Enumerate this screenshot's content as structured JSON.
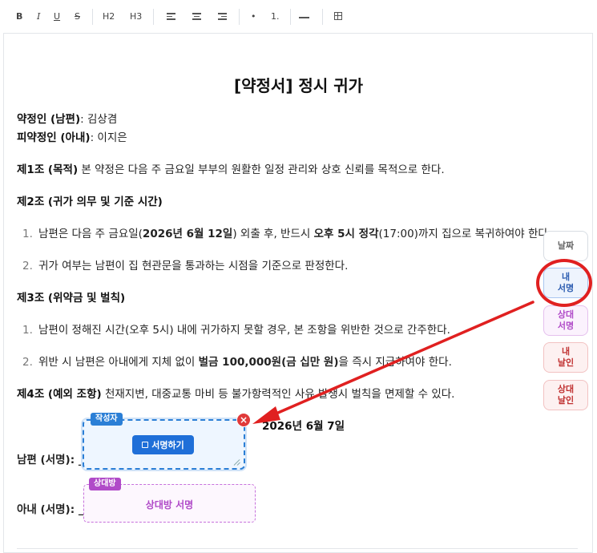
{
  "toolbar": {
    "bold": "B",
    "italic": "I",
    "underline": "U",
    "strike": "S",
    "h2": "H2",
    "h3": "H3",
    "bullet": "•",
    "ordered": "1."
  },
  "document": {
    "title": "[약정서] 정시 귀가",
    "party1_label": "약정인 (남편)",
    "party1_value": ": 김상겸",
    "party2_label": "피약정인 (아내)",
    "party2_value": ": 이지은",
    "art1_head": "제1조 (목적)",
    "art1_body": " 본 약정은 다음 주 금요일 부부의 원활한 일정 관리와 상호 신뢰를 목적으로 한다.",
    "art2_head": "제2조 (귀가 의무 및 기준 시간)",
    "art2_items": [
      {
        "num": "1.",
        "pre": "남편은 다음 주 금요일(",
        "b1": "2026년 6월 12일",
        "mid": ") 외출 후, 반드시 ",
        "b2": "오후 5시 정각",
        "post": "(17:00)까지 집으로 복귀하여야 한다."
      },
      {
        "num": "2.",
        "text": "귀가 여부는 남편이 집 현관문을 통과하는 시점을 기준으로 판정한다."
      }
    ],
    "art3_head": "제3조 (위약금 및 벌칙)",
    "art3_items": [
      {
        "num": "1.",
        "text": "남편이 정해진 시간(오후 5시) 내에 귀가하지 못할 경우, 본 조항을 위반한 것으로 간주한다."
      },
      {
        "num": "2.",
        "pre": "위반 시 남편은 아내에게 지체 없이 ",
        "b1": "벌금 100,000원(금 십만 원)",
        "post": "을 즉시 지급하여야 한다."
      }
    ],
    "art4_head": "제4조 (예외 조항)",
    "art4_body": " 천재지변, 대중교통 마비 등 불가항력적인 사유 발생시 벌칙을 면제할 수 있다.",
    "date": "2026년 6월 7일",
    "husband_sign_label": "남편 (서명): _",
    "wife_sign_label": "아내 (서명): _"
  },
  "signature_box": {
    "tag": "작성자",
    "button": "서명하기",
    "close": "×"
  },
  "other_box": {
    "tag": "상대방",
    "text": "상대방 서명"
  },
  "side_panel": {
    "date": "날짜",
    "my_sign": [
      "내",
      "서명"
    ],
    "their_sign": [
      "상대",
      "서명"
    ],
    "my_seal": [
      "내",
      "날인"
    ],
    "their_seal": [
      "상대",
      "날인"
    ]
  },
  "colors": {
    "annotation_red": "#e02020",
    "primary_blue": "#1f6fd8",
    "purple": "#b04ac8"
  }
}
